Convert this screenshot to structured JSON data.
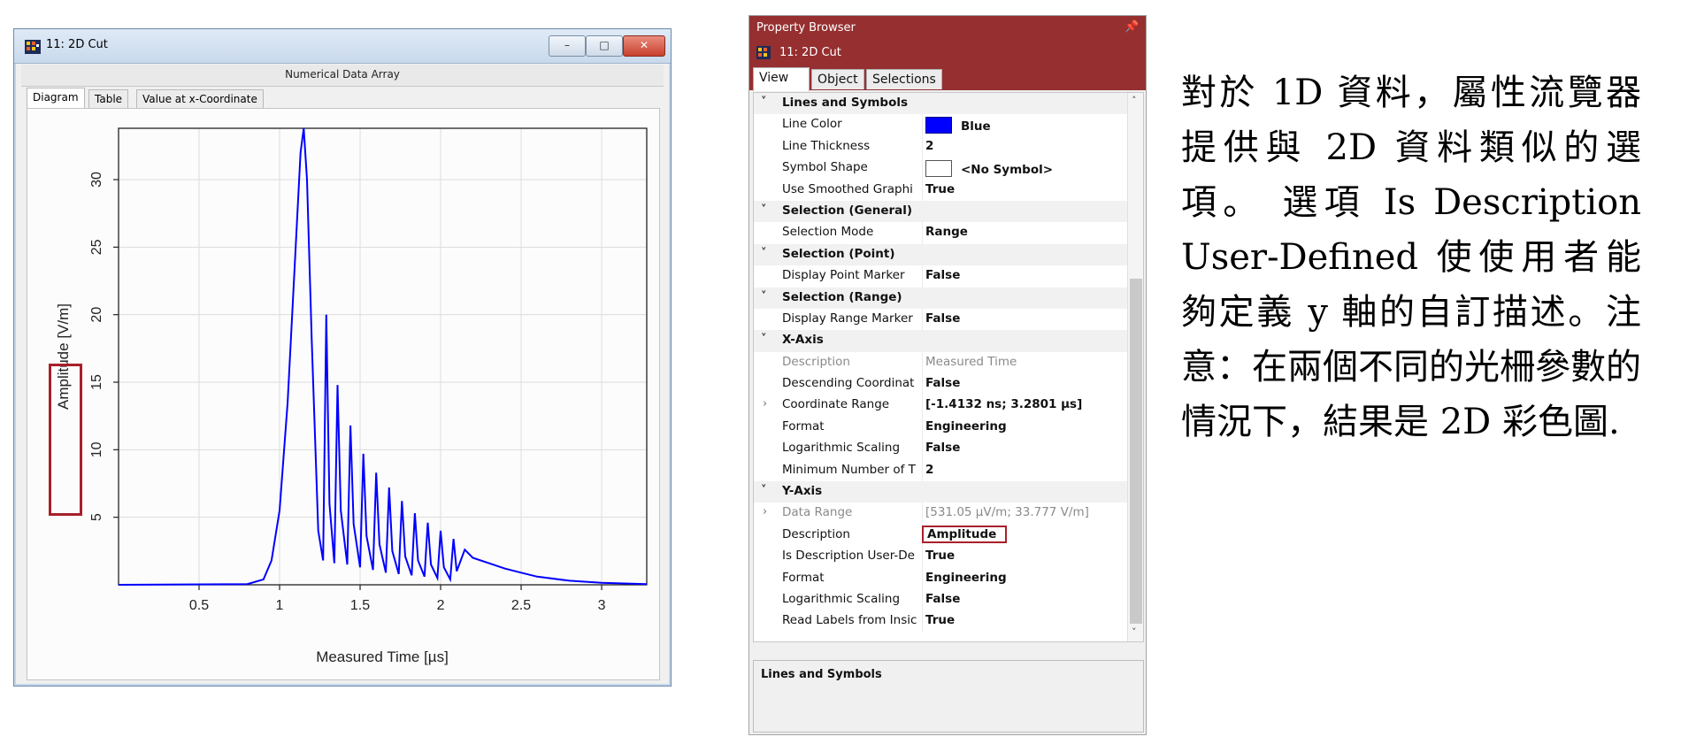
{
  "window": {
    "title": "11: 2D Cut",
    "subtitle": "Numerical Data Array",
    "tabs": [
      "Diagram",
      "Table",
      "Value at x-Coordinate"
    ],
    "active_tab": "Diagram",
    "controls": {
      "minimize": "–",
      "maximize": "□",
      "close": "✕"
    }
  },
  "chart_data": {
    "type": "line",
    "xlabel": "Measured Time [µs]",
    "ylabel": "Amplitude [V/m]",
    "xlim": [
      0,
      3.28
    ],
    "ylim": [
      0,
      33.8
    ],
    "xticks": [
      0.5,
      1,
      1.5,
      2,
      2.5,
      3
    ],
    "yticks": [
      5,
      10,
      15,
      20,
      25,
      30
    ],
    "grid": true,
    "line_color": "#0000ff",
    "series": [
      {
        "x": [
          0.0,
          0.8,
          0.9,
          0.95,
          1.0,
          1.05,
          1.1,
          1.13,
          1.15,
          1.17,
          1.2,
          1.24,
          1.27,
          1.29,
          1.31,
          1.34,
          1.36,
          1.38,
          1.42,
          1.44,
          1.46,
          1.5,
          1.52,
          1.54,
          1.58,
          1.6,
          1.62,
          1.66,
          1.68,
          1.7,
          1.74,
          1.76,
          1.78,
          1.82,
          1.84,
          1.86,
          1.9,
          1.92,
          1.94,
          1.98,
          2.0,
          2.02,
          2.06,
          2.08,
          2.1,
          2.15,
          2.2,
          2.3,
          2.4,
          2.5,
          2.6,
          2.8,
          3.0,
          3.28
        ],
        "y": [
          0.0,
          0.05,
          0.4,
          1.8,
          5.5,
          13.5,
          25.0,
          32.0,
          33.8,
          30.0,
          18.0,
          4.0,
          1.8,
          20.0,
          6.0,
          1.6,
          14.8,
          5.5,
          1.5,
          11.8,
          4.5,
          1.3,
          9.7,
          3.6,
          1.1,
          8.3,
          3.0,
          0.9,
          7.2,
          2.5,
          0.8,
          6.2,
          2.1,
          0.7,
          5.3,
          1.8,
          0.6,
          4.6,
          1.5,
          0.5,
          4.0,
          1.3,
          0.4,
          3.4,
          1.0,
          2.6,
          2.0,
          1.6,
          1.2,
          0.9,
          0.6,
          0.3,
          0.15,
          0.05
        ]
      }
    ]
  },
  "property_browser": {
    "title": "Property Browser",
    "pin": "📌",
    "object": "11: 2D Cut",
    "tabs": [
      "View",
      "Object",
      "Selections"
    ],
    "active_tab": "View",
    "rows": [
      {
        "type": "cat",
        "name": "Lines and Symbols"
      },
      {
        "type": "prop",
        "name": "Line Color",
        "value": "Blue",
        "swatch": "blue"
      },
      {
        "type": "prop",
        "name": "Line Thickness",
        "value": "2"
      },
      {
        "type": "prop",
        "name": "Symbol Shape",
        "value": "<No Symbol>",
        "swatch": "empty"
      },
      {
        "type": "prop",
        "name": "Use Smoothed Graphi",
        "value": "True"
      },
      {
        "type": "cat",
        "name": "Selection (General)"
      },
      {
        "type": "prop",
        "name": "Selection Mode",
        "value": "Range"
      },
      {
        "type": "cat",
        "name": "Selection (Point)"
      },
      {
        "type": "prop",
        "name": "Display Point Marker",
        "value": "False"
      },
      {
        "type": "cat",
        "name": "Selection (Range)"
      },
      {
        "type": "prop",
        "name": "Display Range Marker",
        "value": "False"
      },
      {
        "type": "cat",
        "name": "X-Axis"
      },
      {
        "type": "prop",
        "name": "Description",
        "value": "Measured Time",
        "grey": true
      },
      {
        "type": "prop",
        "name": "Descending Coordinat",
        "value": "False"
      },
      {
        "type": "prop",
        "name": "Coordinate Range",
        "value": "[-1.4132 ns; 3.2801 µs]",
        "expand": true
      },
      {
        "type": "prop",
        "name": "Format",
        "value": "Engineering"
      },
      {
        "type": "prop",
        "name": "Logarithmic Scaling",
        "value": "False"
      },
      {
        "type": "prop",
        "name": "Minimum Number of T",
        "value": "2"
      },
      {
        "type": "cat",
        "name": "Y-Axis"
      },
      {
        "type": "prop",
        "name": "Data Range",
        "value": "[531.05 µV/m; 33.777 V/m]",
        "grey": true,
        "expand": true
      },
      {
        "type": "prop",
        "name": "Description",
        "value": "Amplitude",
        "highlight": true
      },
      {
        "type": "prop",
        "name": "Is Description User-De",
        "value": "True"
      },
      {
        "type": "prop",
        "name": "Format",
        "value": "Engineering"
      },
      {
        "type": "prop",
        "name": "Logarithmic Scaling",
        "value": "False"
      },
      {
        "type": "prop",
        "name": "Read Labels from Insic",
        "value": "True"
      }
    ],
    "description_panel": "Lines and Symbols",
    "colors": {
      "header": "#962f30",
      "highlight": "#a7202b"
    }
  },
  "note": {
    "text": "對於 1D 資料，屬性流覽器提供與 2D 資料類似的選項。 選項 Is Description User-Defined 使使用者能夠定義 y 軸的自訂描述。注意：在兩個不同的光柵參數的情況下，結果是 2D 彩色圖."
  }
}
